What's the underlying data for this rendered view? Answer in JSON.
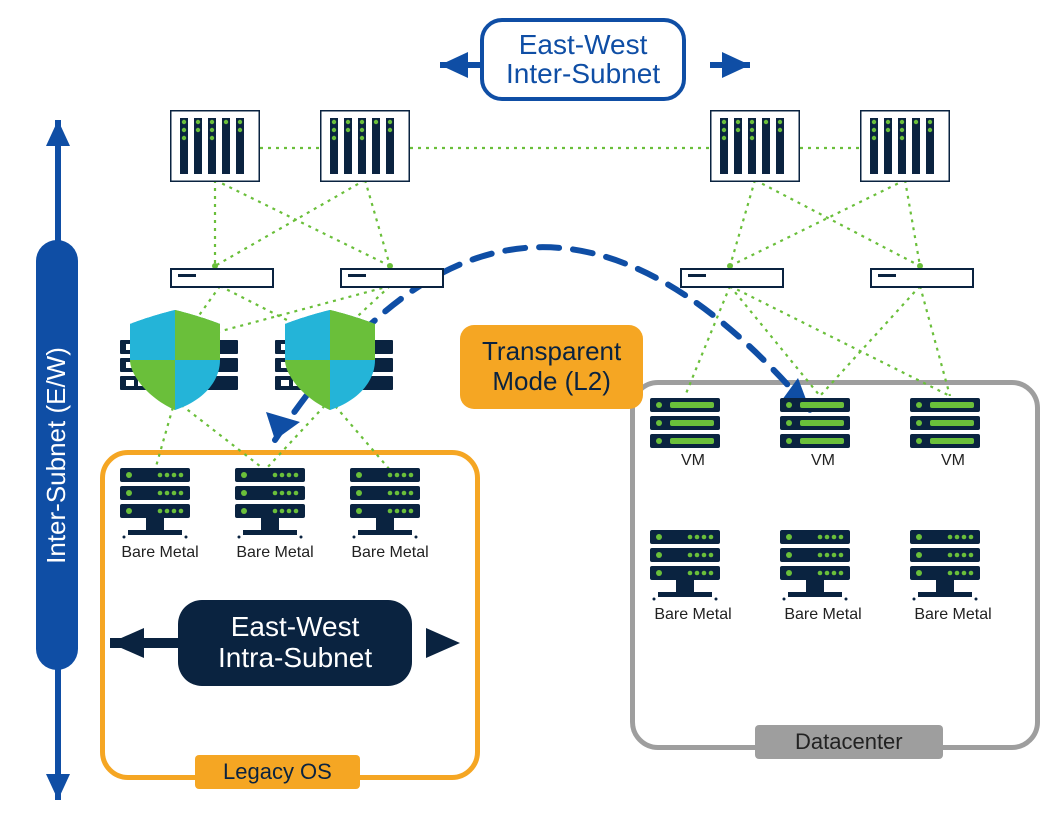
{
  "labels": {
    "top_pill_line1": "East-West",
    "top_pill_line2": "Inter-Subnet",
    "center_pill_line1": "Transparent",
    "center_pill_line2": "Mode (L2)",
    "navy_pill_line1": "East-West",
    "navy_pill_line2": "Intra-Subnet",
    "vbar": "Inter-Subnet (E/W)",
    "legacy_tag": "Legacy OS",
    "datacenter_tag": "Datacenter",
    "bare_metal": "Bare Metal",
    "vm": "VM"
  },
  "meta": {
    "icons": {
      "core_switch": "core-switch-icon",
      "access_switch": "access-switch-icon",
      "firewall": "shield-firewall-icon",
      "server": "server-rack-icon",
      "vm_server": "vm-server-icon"
    },
    "colors": {
      "blue": "#0f4ea5",
      "navy": "#0a2340",
      "orange": "#f5a623",
      "gray": "#9e9e9e",
      "green": "#6abf3a",
      "cyan": "#24b4d8"
    }
  }
}
